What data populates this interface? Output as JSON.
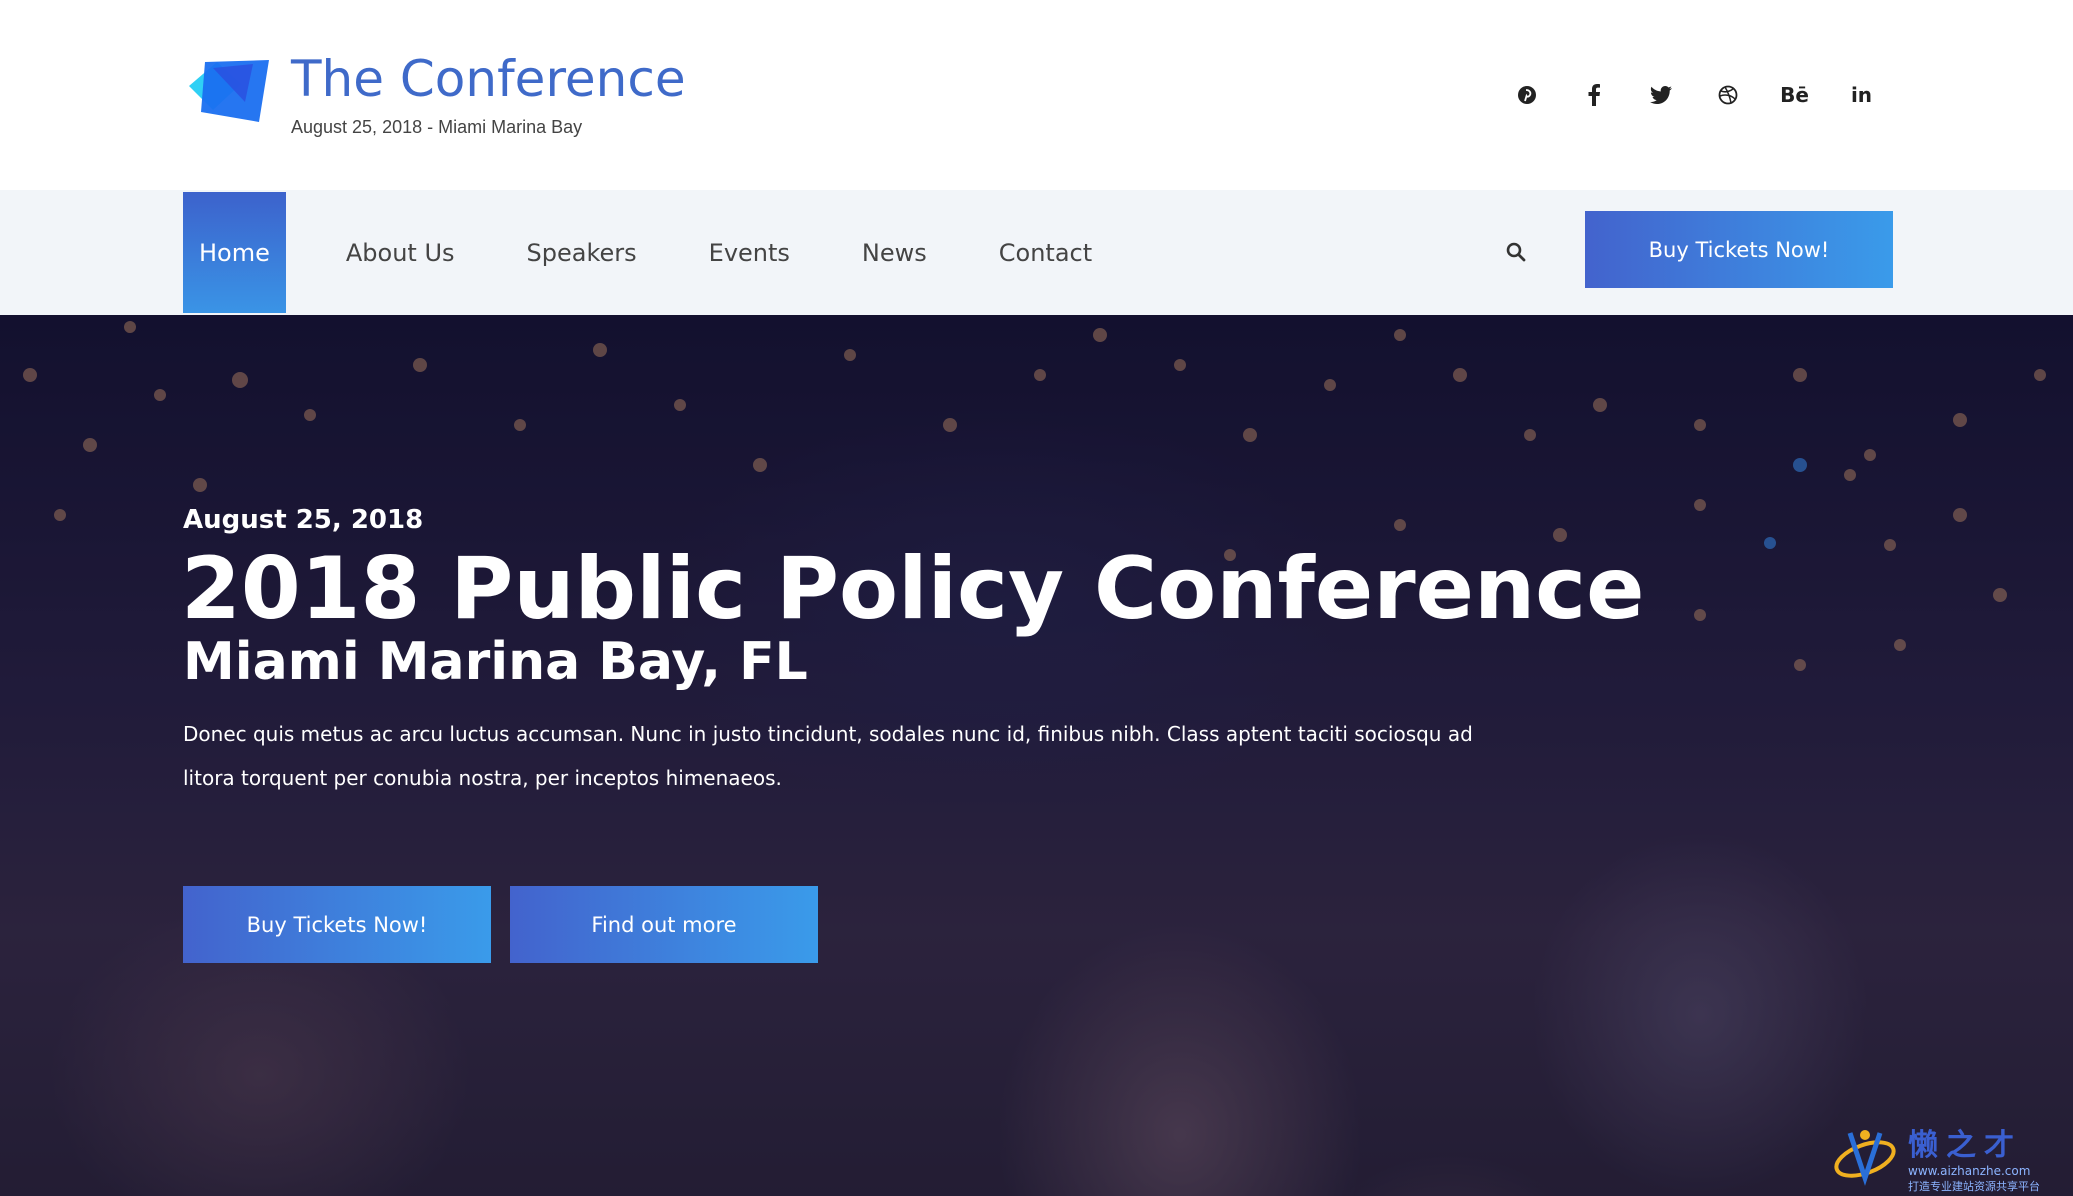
{
  "header": {
    "logo_title": "The Conference",
    "logo_subtitle": "August 25, 2018 - Miami Marina Bay",
    "social_icons": [
      "pinterest-icon",
      "facebook-icon",
      "twitter-icon",
      "dribbble-icon",
      "behance-icon",
      "linkedin-icon"
    ],
    "behance_label": "Bē",
    "linkedin_label": "in"
  },
  "nav": {
    "items": [
      {
        "label": "Home",
        "active": true
      },
      {
        "label": "About Us",
        "active": false
      },
      {
        "label": "Speakers",
        "active": false
      },
      {
        "label": "Events",
        "active": false
      },
      {
        "label": "News",
        "active": false
      },
      {
        "label": "Contact",
        "active": false
      }
    ],
    "search_icon": "search-icon",
    "cta_label": "Buy Tickets Now!"
  },
  "hero": {
    "date": "August 25, 2018",
    "title": "2018 Public Policy Conference",
    "subtitle": "Miami Marina Bay, FL",
    "description": "Donec quis metus ac arcu luctus accumsan. Nunc in justo tincidunt, sodales nunc id, finibus nibh. Class aptent taciti sociosqu ad litora torquent per conubia nostra, per inceptos himenaeos.",
    "primary_button": "Buy Tickets Now!",
    "secondary_button": "Find out more"
  },
  "watermark": {
    "chinese": "懒之才",
    "url": "www.aizhanzhe.com",
    "tagline": "打造专业建站资源共享平台"
  },
  "colors": {
    "brand_blue": "#3f6ac9",
    "gradient_start": "#4363cd",
    "gradient_end": "#3a9bea",
    "nav_bg": "#f2f5f9",
    "hero_dark": "#14122e"
  }
}
